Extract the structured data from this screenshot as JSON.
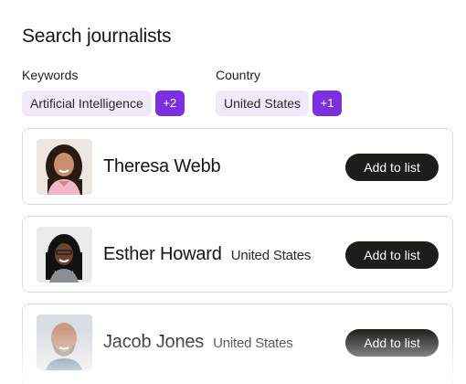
{
  "title": "Search journalists",
  "filters": {
    "keywords": {
      "label": "Keywords",
      "value": "Artificial Intelligence",
      "more": "+2"
    },
    "country": {
      "label": "Country",
      "value": "United States",
      "more": "+1"
    }
  },
  "journalists": [
    {
      "name": "Theresa Webb",
      "country": "",
      "action": "Add to list"
    },
    {
      "name": "Esther Howard",
      "country": "United States",
      "action": "Add to list"
    },
    {
      "name": "Jacob Jones",
      "country": "United States",
      "action": "Add to list"
    }
  ],
  "colors": {
    "chip_bg": "#efe9fb",
    "accent": "#7b2fe0",
    "button_bg": "#1b1e19"
  }
}
